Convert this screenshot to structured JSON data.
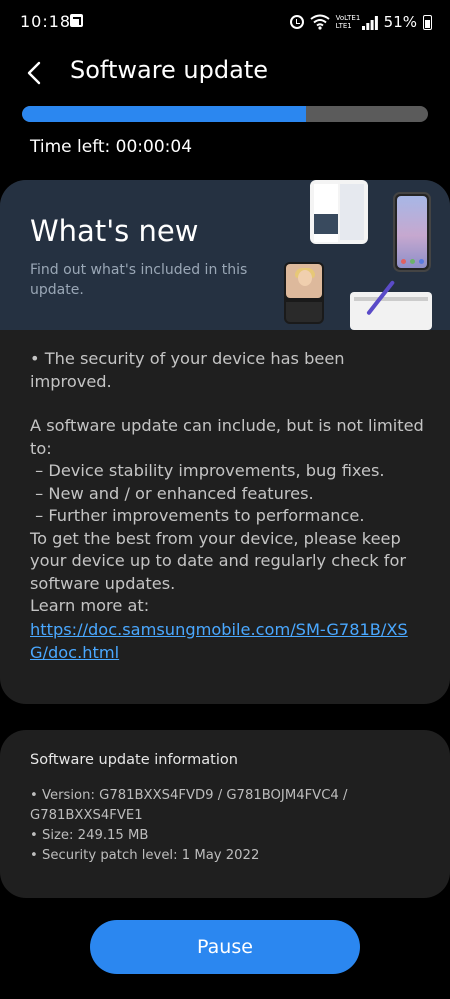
{
  "status_bar": {
    "time": "10:18",
    "volte_label": "VoLTE1 LTE1",
    "battery": "51%",
    "icons": [
      "share-icon",
      "alarm-icon",
      "wifi-icon",
      "signal-icon",
      "battery-icon"
    ]
  },
  "app_bar": {
    "title": "Software update",
    "back_icon": "back-arrow-icon"
  },
  "progress": {
    "fraction": 0.7
  },
  "time_left": "Time left: 00:00:04",
  "whats_new": {
    "title": "What's new",
    "subtitle": "Find out what's included in this update.",
    "body": {
      "security": "• The security of your device has been improved.",
      "intro": "A software update can include, but is not limited to:",
      "items": [
        " – Device stability improvements, bug fixes.",
        " – New and / or enhanced features.",
        " – Further improvements to performance."
      ],
      "advice": "To get the best from your device, please keep your device up to date and regularly check for software updates.",
      "learn_more_label": "Learn more at:",
      "learn_more_link": "https://doc.samsungmobile.com/SM-G781B/XSG/doc.html"
    }
  },
  "info": {
    "title": "Software update information",
    "items": [
      "• Version: G781BXXS4FVD9 / G781BOJM4FVC4 / G781BXXS4FVE1",
      "• Size: 249.15 MB",
      "• Security patch level: 1 May 2022"
    ]
  },
  "pause_button": {
    "label": "Pause"
  },
  "colors": {
    "accent": "#2b87f0",
    "link": "#4aa8ff",
    "card": "#1f1f1f",
    "header": "#253141"
  }
}
